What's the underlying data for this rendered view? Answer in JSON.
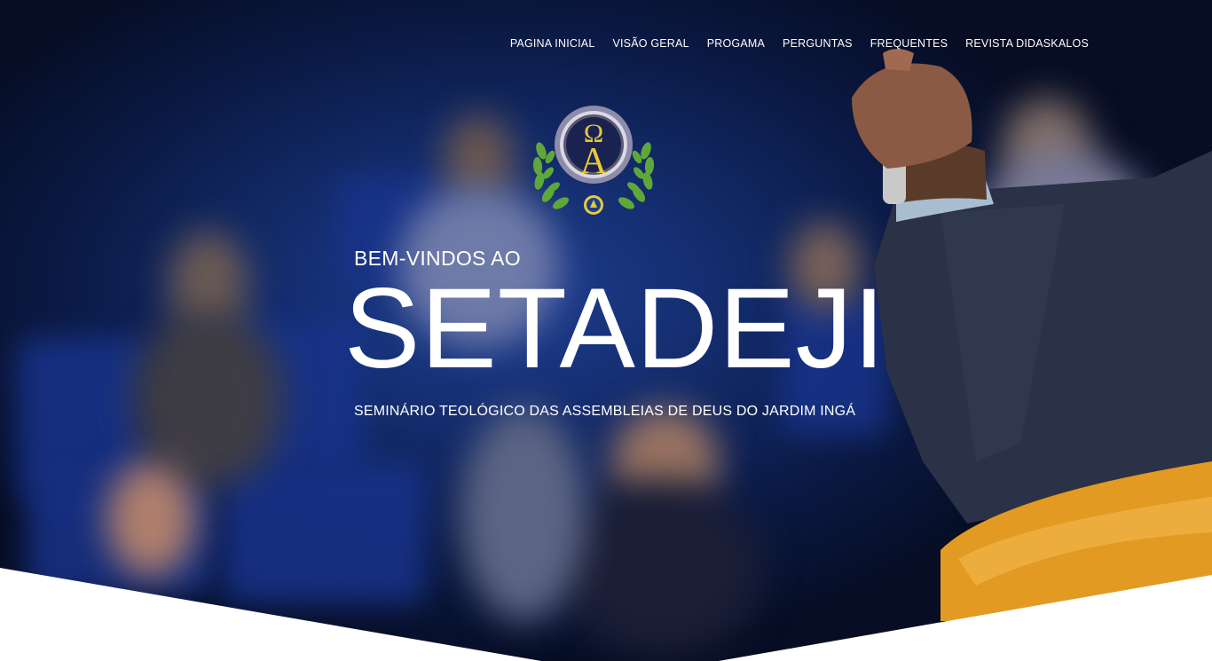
{
  "nav": {
    "items": [
      {
        "label": "PAGINA INICIAL"
      },
      {
        "label": "VISÃO GERAL"
      },
      {
        "label": "PROGAMA"
      },
      {
        "label": "PERGUNTAS"
      },
      {
        "label": "FREQUENTES"
      },
      {
        "label": "REVISTA DIDASKALOS"
      }
    ]
  },
  "hero": {
    "welcome": "BEM-VINDOS AO",
    "title": "SETADEJI",
    "subtitle": "SEMINÁRIO TEOLÓGICO DAS ASSEMBLEIAS DE DEUS DO JARDIM INGÁ"
  },
  "colors": {
    "background_dark": "#0b1a45",
    "background_blue": "#1e3f92",
    "logo_gold": "#e8c93a",
    "logo_green": "#5ea83a",
    "accent_orange": "#e39a22"
  }
}
